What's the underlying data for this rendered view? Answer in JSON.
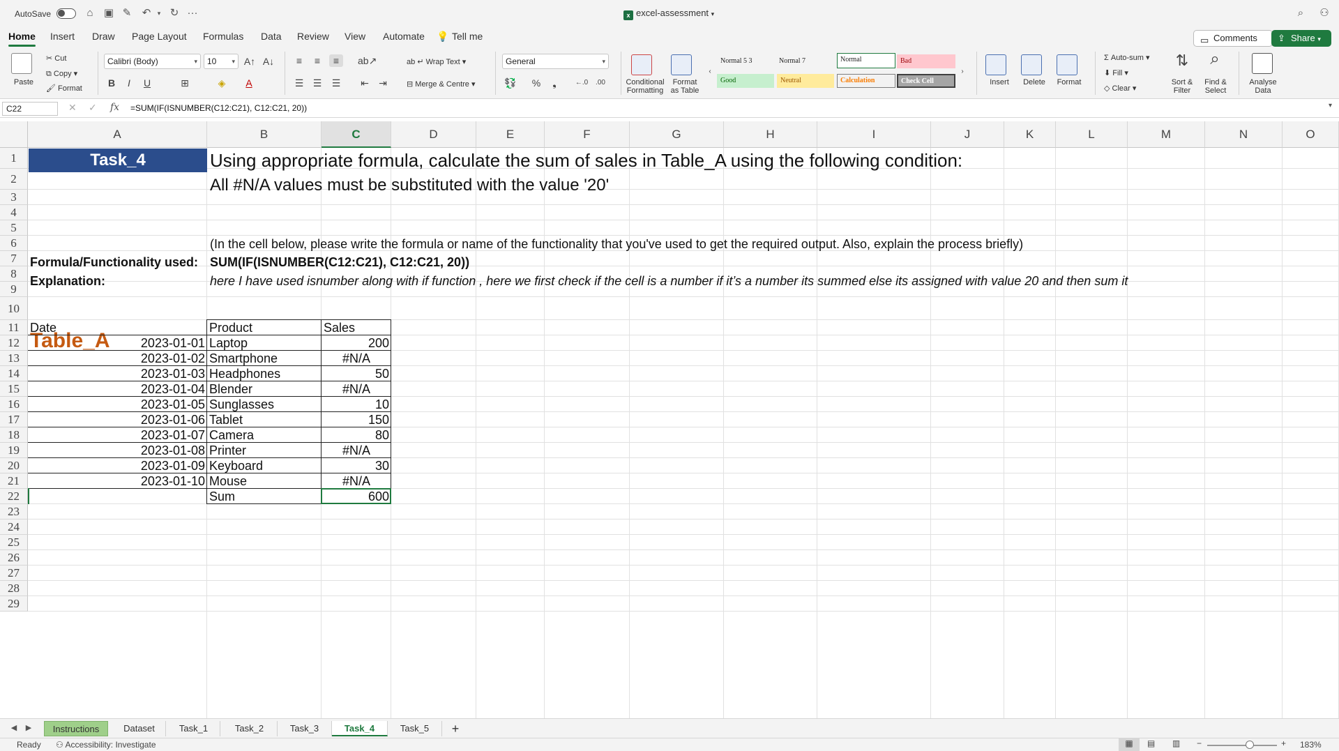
{
  "titlebar": {
    "autosave_label": "AutoSave",
    "doc_title": "excel-assessment",
    "more": "···"
  },
  "ribbon_tabs": [
    "Home",
    "Insert",
    "Draw",
    "Page Layout",
    "Formulas",
    "Data",
    "Review",
    "View",
    "Automate",
    "Tell me"
  ],
  "actions": {
    "comments": "Comments",
    "share": "Share"
  },
  "ribbon": {
    "paste": "Paste",
    "cut": "Cut",
    "copy": "Copy",
    "format": "Format",
    "font_name": "Calibri (Body)",
    "font_size": "10",
    "bold": "B",
    "italic": "I",
    "underline": "U",
    "wrap_text": "Wrap Text",
    "merge_centre": "Merge & Centre",
    "number_format": "General",
    "conditional_formatting": "Conditional\nFormatting",
    "format_as_table": "Format\nas Table",
    "styles": [
      "Normal 5 3",
      "Normal 7",
      "Normal",
      "Bad",
      "Good",
      "Neutral",
      "Calculation",
      "Check Cell"
    ],
    "insert": "Insert",
    "delete": "Delete",
    "format_cells": "Format",
    "autosum": "Auto-sum",
    "fill": "Fill",
    "clear": "Clear",
    "sort_filter": "Sort &\nFilter",
    "find_select": "Find &\nSelect",
    "analyse_data": "Analyse\nData"
  },
  "formula_bar": {
    "name_box": "C22",
    "formula": "=SUM(IF(ISNUMBER(C12:C21), C12:C21, 20))"
  },
  "columns": [
    "A",
    "B",
    "C",
    "D",
    "E",
    "F",
    "G",
    "H",
    "I",
    "J",
    "K",
    "L",
    "M",
    "N",
    "O"
  ],
  "rows": [
    "1",
    "2",
    "3",
    "4",
    "5",
    "6",
    "7",
    "8",
    "9",
    "10",
    "11",
    "12",
    "13",
    "14",
    "15",
    "16",
    "17",
    "18",
    "19",
    "20",
    "21",
    "22",
    "23",
    "24",
    "25",
    "26",
    "27",
    "28",
    "29"
  ],
  "sheet": {
    "task_title": "Task_4",
    "r1_text": "Using appropriate formula, calculate the sum of sales in Table_A using the following condition:",
    "r2_text": "All #N/A values must be substituted with the value '20'",
    "r5_text": "(In the cell below, please write the formula or name of the functionality that you've used to get the required output. Also, explain the process briefly)",
    "r6_label": "Formula/Functionality used:",
    "r6_value": "SUM(IF(ISNUMBER(C12:C21), C12:C21, 20))",
    "r7_label": "Explanation:",
    "r7_value": "here I have used isnumber along with if function , here we first check if the cell is a number if it’s a number its summed else its assigned with value 20 and then sum it",
    "table_title": "Table_A",
    "headers": [
      "Date",
      "Product",
      "Sales"
    ],
    "table_rows": [
      [
        "2023-01-01",
        "Laptop",
        "200"
      ],
      [
        "2023-01-02",
        "Smartphone",
        "#N/A"
      ],
      [
        "2023-01-03",
        "Headphones",
        "50"
      ],
      [
        "2023-01-04",
        "Blender",
        "#N/A"
      ],
      [
        "2023-01-05",
        "Sunglasses",
        "10"
      ],
      [
        "2023-01-06",
        "Tablet",
        "150"
      ],
      [
        "2023-01-07",
        "Camera",
        "80"
      ],
      [
        "2023-01-08",
        "Printer",
        "#N/A"
      ],
      [
        "2023-01-09",
        "Keyboard",
        "30"
      ],
      [
        "2023-01-10",
        "Mouse",
        "#N/A"
      ]
    ],
    "sum_label": "Sum",
    "sum_value": "600"
  },
  "sheet_tabs": [
    "Instructions",
    "Dataset",
    "Task_1",
    "Task_2",
    "Task_3",
    "Task_4",
    "Task_5"
  ],
  "add_sheet": "+",
  "status": {
    "ready": "Ready",
    "accessibility": "Accessibility: Investigate",
    "zoom": "183%"
  }
}
